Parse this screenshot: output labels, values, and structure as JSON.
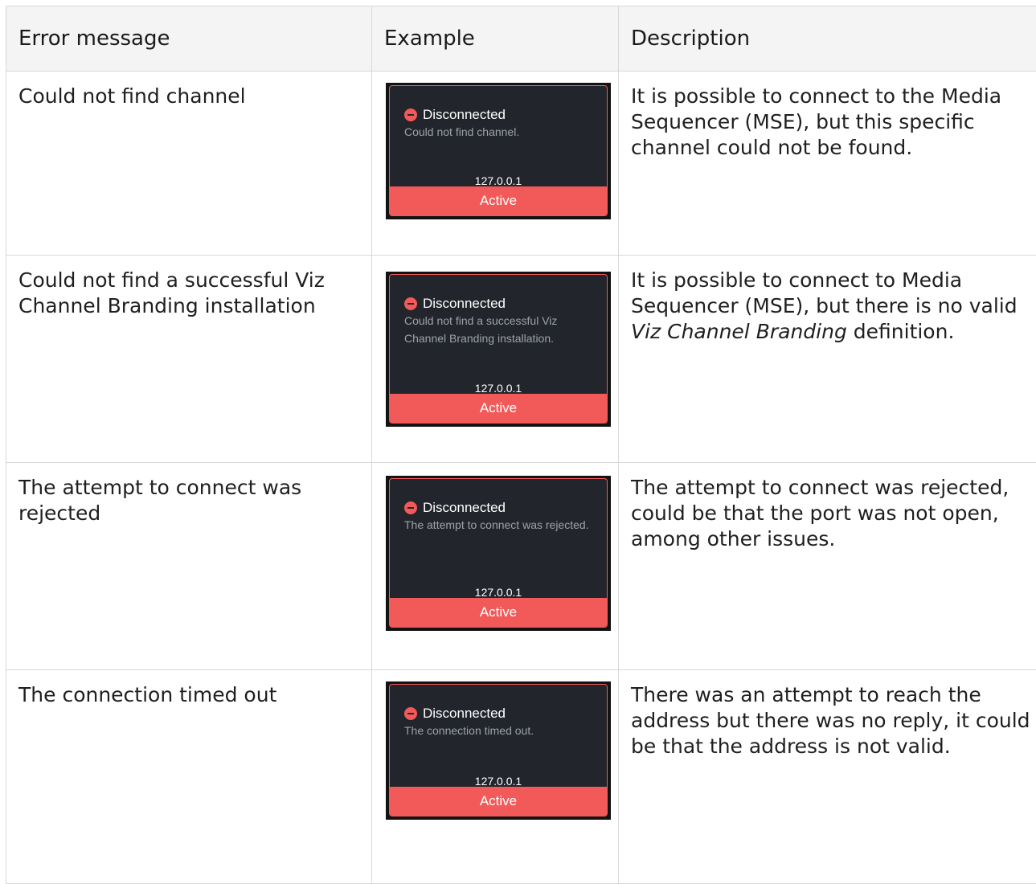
{
  "headers": {
    "col1": "Error message",
    "col2": "Example",
    "col3": "Description"
  },
  "rows": [
    {
      "message": "Could not find channel",
      "card": {
        "status": "Disconnected",
        "detail": "Could not find channel.",
        "ip": "127.0.0.1",
        "state": "Active"
      },
      "description": "It is possible to connect to the Media Sequencer (MSE), but this specific channel could not be found."
    },
    {
      "message": "Could not find a successful Viz Channel Branding installation",
      "card": {
        "status": "Disconnected",
        "detail": "Could not find a successful Viz Channel Branding installation.",
        "ip": "127.0.0.1",
        "state": "Active"
      },
      "description_pre": "It is possible to connect to Media Sequencer (MSE), but there is no valid ",
      "description_em": "Viz Channel Branding",
      "description_post": " definition."
    },
    {
      "message": "The attempt to connect was rejected",
      "card": {
        "status": "Disconnected",
        "detail": "The attempt to connect was rejected.",
        "ip": "127.0.0.1",
        "state": "Active"
      },
      "description": "The attempt to connect was rejected, could be that the port was not open, among other issues."
    },
    {
      "message": "The connection timed out",
      "card": {
        "status": "Disconnected",
        "detail": "The connection timed out.",
        "ip": "127.0.0.1",
        "state": "Active"
      },
      "description": "There was an attempt to reach the address but there was no reply, it could be that the address is not valid."
    }
  ]
}
